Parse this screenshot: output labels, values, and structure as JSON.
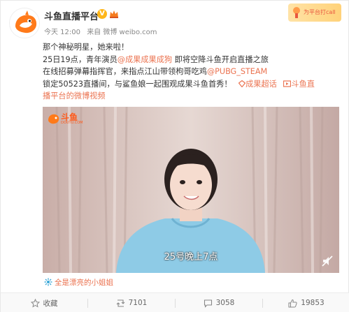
{
  "account": {
    "name": "斗鱼直播平台",
    "verify_mark": "V"
  },
  "meta": {
    "time": "今天 12:00",
    "source": "来自 微博 weibo.com"
  },
  "badge": {
    "text": "为平台打call"
  },
  "post": {
    "line1": "那个神秘明星，她来啦！",
    "line2_prefix": "25日19点，青年演员",
    "line2_mention": "@成果成果成狗",
    "line2_suffix": " 即将空降斗鱼开启直播之旅",
    "line3_prefix": "在线招募弹幕指挥官，来指点江山带领枸哥吃鸡",
    "line3_mention": "@PUBG_STEAM",
    "line4_prefix": "锁定50523直播间，与鲨鱼娘一起围观成果斗鱼首秀！",
    "line4_topic": "成果超话",
    "line4_link": "斗鱼直",
    "line5_link": "播平台的微博视频"
  },
  "video": {
    "logo_text": "斗鱼",
    "logo_sub": "DOUYU.COM",
    "subtitle": "25号晚上7点"
  },
  "tag": {
    "text": "全是漂亮的小姐姐"
  },
  "actions": {
    "favorite": "收藏",
    "repost": "7101",
    "comment": "3058",
    "like": "19853"
  },
  "colors": {
    "link": "#eb7350",
    "verify": "#ffb619"
  }
}
